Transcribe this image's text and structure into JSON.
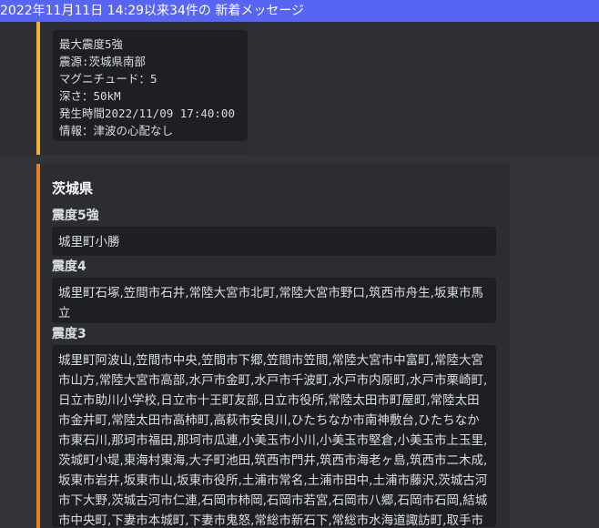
{
  "banner": {
    "text": "2022年11月11日 14:29以来34件の 新着メッセージ"
  },
  "first_embed": {
    "lines": [
      "最大震度5強",
      "震源:茨城県南部",
      "マグニチュード：5",
      "深さ：50kM",
      "発生時間2022/11/09 17:40:00",
      "情報：津波の心配なし"
    ]
  },
  "second_embed": {
    "title": "茨城県",
    "levels": [
      {
        "label": "震度5強",
        "text": "城里町小勝"
      },
      {
        "label": "震度4",
        "text": "城里町石塚,笠間市石井,常陸大宮市北町,常陸大宮市野口,筑西市舟生,坂東市馬立"
      },
      {
        "label": "震度3",
        "text": "城里町阿波山,笠間市中央,笠間市下郷,笠間市笠間,常陸大宮市中富町,常陸大宮市山方,常陸大宮市高部,水戸市金町,水戸市千波町,水戸市内原町,水戸市栗崎町,日立市助川小学校,日立市十王町友部,日立市役所,常陸太田市町屋町,常陸太田市金井町,常陸太田市高柿町,高萩市安良川,ひたちなか市南神敷台,ひたちなか市東石川,那珂市福田,那珂市瓜連,小美玉市小川,小美玉市堅倉,小美玉市上玉里,茨城町小堤,東海村東海,大子町池田,筑西市門井,筑西市海老ヶ島,筑西市二木成,坂東市岩井,坂東市山,坂東市役所,土浦市常名,土浦市田中,土浦市藤沢,茨城古河市下大野,茨城古河市仁連,石岡市柿岡,石岡市若宮,石岡市八郷,石岡市石岡,結城市中央町,下妻市本城町,下妻市鬼怒,常総市新石下,常総市水海道諏訪町,取手市寺田,つくば市天王台,つくば市研究学園,つくば市小茎,茨城鹿嶋市鉢形,茨城鹿嶋市宮中,行方市麻生"
      }
    ]
  }
}
